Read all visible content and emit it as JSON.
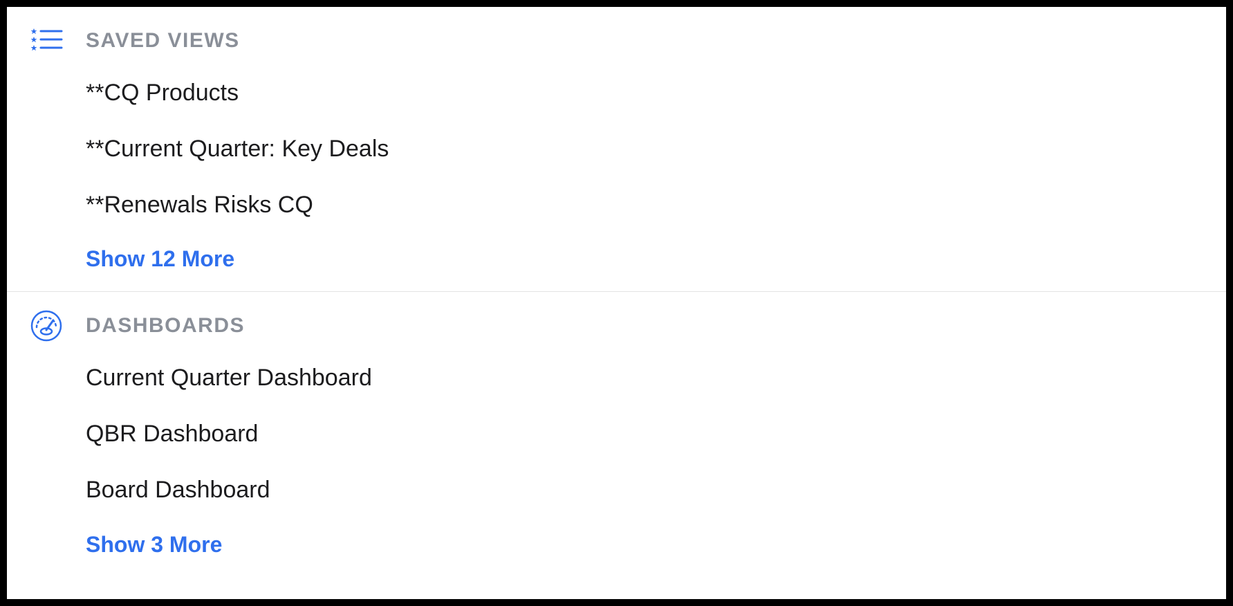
{
  "sections": {
    "saved_views": {
      "title": "SAVED VIEWS",
      "items": [
        "**CQ Products",
        "**Current Quarter: Key Deals",
        "**Renewals Risks CQ"
      ],
      "show_more": "Show 12 More"
    },
    "dashboards": {
      "title": "DASHBOARDS",
      "items": [
        "Current Quarter Dashboard",
        "QBR Dashboard",
        "Board Dashboard"
      ],
      "show_more": "Show 3 More"
    }
  },
  "colors": {
    "accent": "#2f6fed",
    "muted": "#8a8f98",
    "text": "#1c1c1e",
    "divider": "#e4e4e4"
  }
}
